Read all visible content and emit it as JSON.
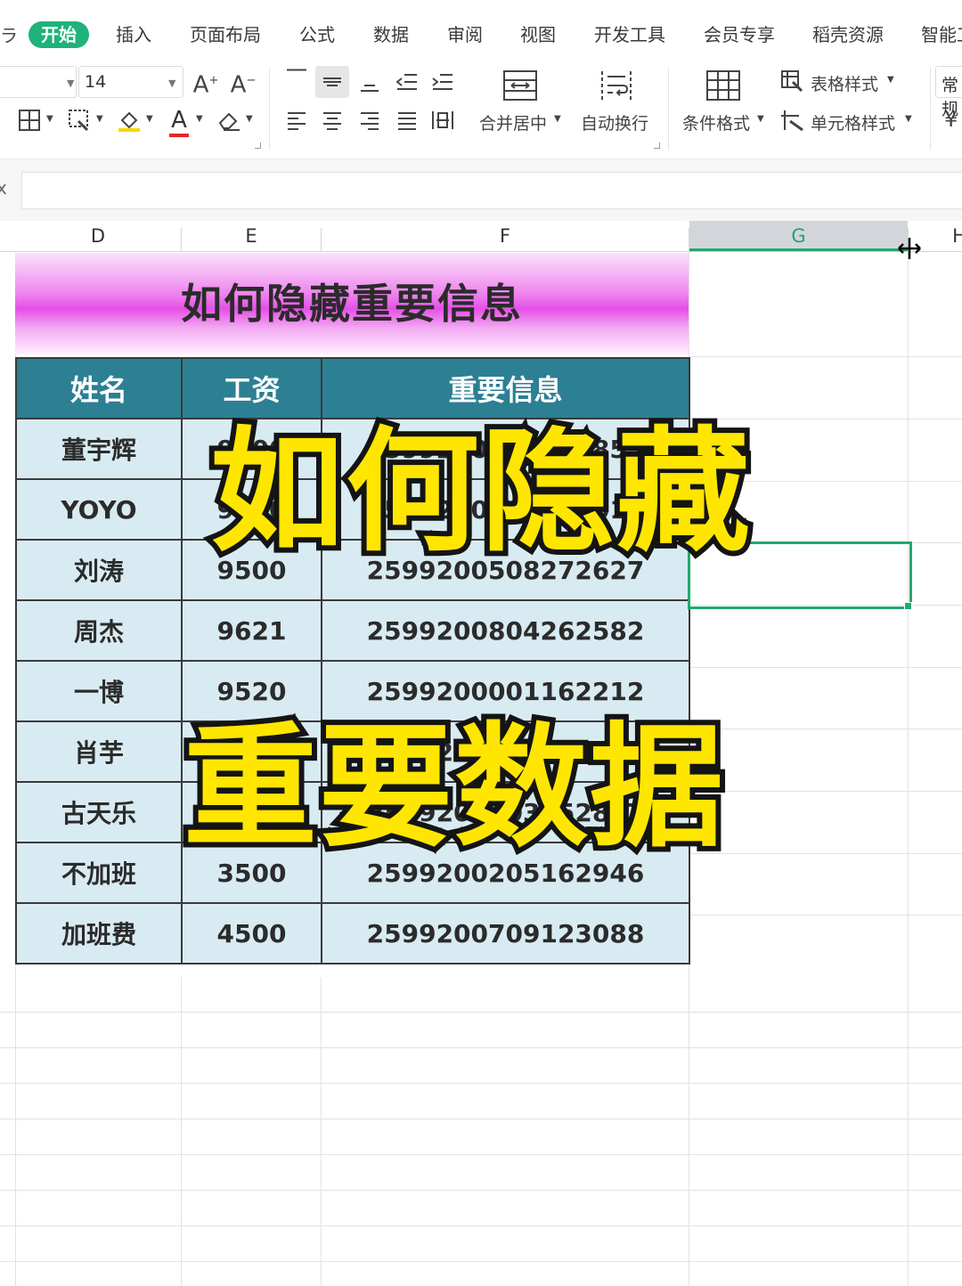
{
  "ribbon": {
    "menu_edge": "ラ",
    "tabs": [
      {
        "label": "开始",
        "active": true
      },
      {
        "label": "插入"
      },
      {
        "label": "页面布局"
      },
      {
        "label": "公式"
      },
      {
        "label": "数据"
      },
      {
        "label": "审阅"
      },
      {
        "label": "视图"
      },
      {
        "label": "开发工具"
      },
      {
        "label": "会员专享"
      },
      {
        "label": "稻壳资源"
      },
      {
        "label": "智能工"
      }
    ],
    "font_size": "14",
    "merge_center": "合并居中",
    "wrap_text": "自动换行",
    "conditional_format": "条件格式",
    "table_style": "表格样式",
    "cell_style": "单元格样式",
    "number_format": "常规",
    "currency_icon": "¥",
    "accent_color": "#1fb27a"
  },
  "formula_bar": {
    "fx_label": "x",
    "value": ""
  },
  "sheet": {
    "columns": [
      "D",
      "E",
      "F",
      "G",
      "H"
    ],
    "selected_column": "G",
    "title": "如何隐藏重要信息",
    "headers": [
      "姓名",
      "工资",
      "重要信息"
    ],
    "rows": [
      [
        "董宇辉",
        "9600",
        "2599200605112853"
      ],
      [
        "YOYO",
        "9800",
        "2599200909212010"
      ],
      [
        "刘涛",
        "9500",
        "2599200508272627"
      ],
      [
        "周杰",
        "9621",
        "2599200804262582"
      ],
      [
        "一博",
        "9520",
        "2599200001162212"
      ],
      [
        "肖芋",
        "9600",
        "2599200702142836"
      ],
      [
        "古天乐",
        "9700",
        "2599200403152877"
      ],
      [
        "不加班",
        "3500",
        "2599200205162946"
      ],
      [
        "加班费",
        "4500",
        "2599200709123088"
      ]
    ],
    "header_color": "#2d7f93",
    "row_color": "#d9ebf2",
    "title_color": "#e64fe6"
  },
  "overlay": {
    "line1": "如何隐藏",
    "line2": "重要数据",
    "color": "#ffe600"
  }
}
